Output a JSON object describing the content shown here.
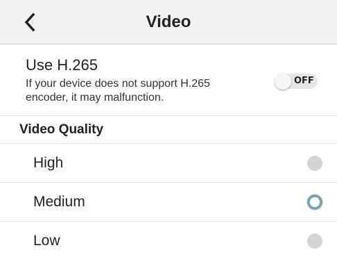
{
  "header": {
    "title": "Video",
    "back_icon": "chevron-left-icon"
  },
  "h265": {
    "title": "Use H.265",
    "description": "If your device does not support H.265 encoder, it may malfunction.",
    "toggle_state": "OFF",
    "enabled": false
  },
  "video_quality": {
    "section_title": "Video Quality",
    "selected": "Medium",
    "options": [
      {
        "label": "High",
        "selected": false
      },
      {
        "label": "Medium",
        "selected": true
      },
      {
        "label": "Low",
        "selected": false
      }
    ]
  },
  "colors": {
    "header_bg": "#f2f2f2",
    "radio_unselected": "#d4d4d4",
    "radio_selected_ring": "#8a9aa6",
    "radio_selected_glow": "#5ab8d6",
    "toggle_track": "#e6e6e6"
  }
}
